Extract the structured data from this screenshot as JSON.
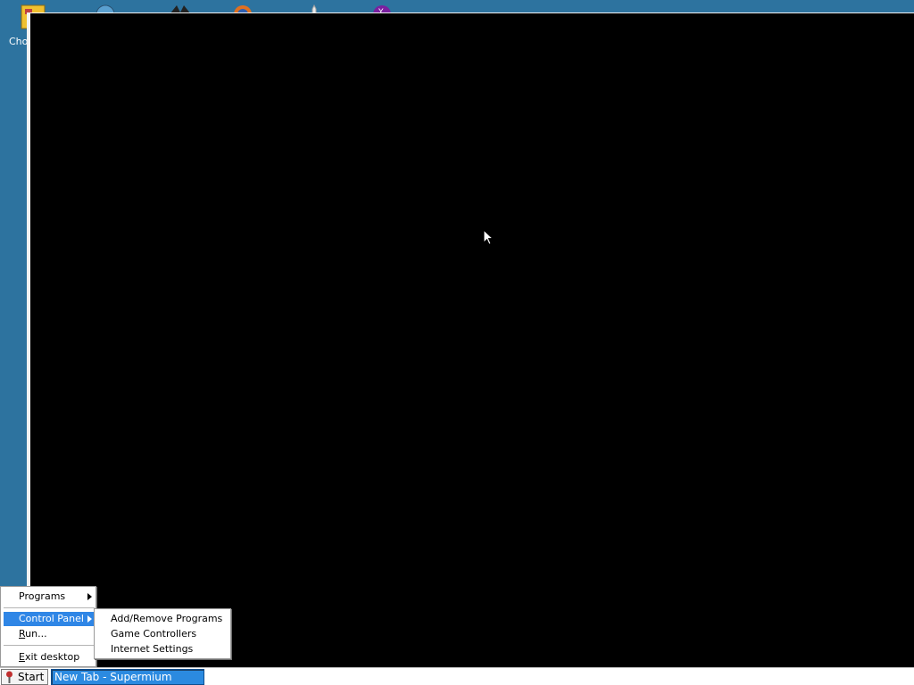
{
  "desktop": {
    "icons": [
      {
        "name": "document-icon",
        "color": "#f0c030"
      },
      {
        "name": "globe-icon",
        "color": "#5aa0d0"
      },
      {
        "name": "butterfly-icon",
        "color": "#222222"
      },
      {
        "name": "firefox-icon",
        "color": "#e07020"
      },
      {
        "name": "rocket-icon",
        "color": "#e8e8e8"
      },
      {
        "name": "yahoo-icon",
        "color": "#7a1fa0"
      }
    ],
    "icon_label": "Cho"
  },
  "window": {
    "background": "#000000"
  },
  "start_menu": {
    "programs_label": "Programs",
    "control_panel_label": "Control Panel",
    "run_label_underlined": "R",
    "run_label_rest": "un...",
    "exit_label_underlined": "E",
    "exit_label_rest": "xit desktop"
  },
  "control_panel_submenu": {
    "items": [
      "Add/Remove Programs",
      "Game Controllers",
      "Internet Settings"
    ]
  },
  "taskbar": {
    "start_label": "Start",
    "tasks": [
      {
        "label": "New Tab - Supermium",
        "active": true
      }
    ]
  },
  "colors": {
    "desktop": "#2d739f",
    "selection": "#2f86e6",
    "task_active": "#2b8ae0"
  }
}
